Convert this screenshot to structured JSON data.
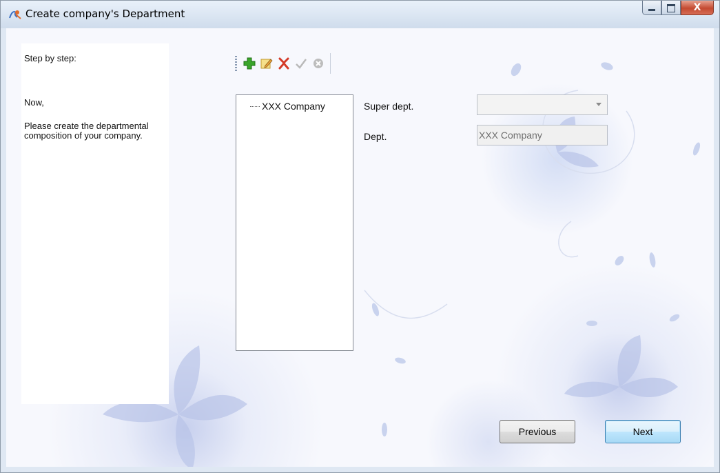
{
  "window": {
    "title": "Create company's Department",
    "caption_buttons": {
      "minimize_icon": "minimize-icon",
      "maximize_icon": "maximize-icon",
      "close_glyph": "X"
    }
  },
  "steps": {
    "title": "Step by step:",
    "now": "Now,",
    "description": "Please create the departmental composition of your company."
  },
  "toolbar": {
    "items": [
      {
        "icon": "add-icon",
        "enabled": true
      },
      {
        "icon": "edit-icon",
        "enabled": true
      },
      {
        "icon": "delete-icon",
        "enabled": true
      },
      {
        "icon": "confirm-icon",
        "enabled": false
      },
      {
        "icon": "cancel-icon",
        "enabled": false
      }
    ]
  },
  "tree": {
    "root": "XXX Company"
  },
  "form": {
    "super_dept_label": "Super dept.",
    "super_dept_value": "",
    "dept_label": "Dept.",
    "dept_value": "XXX Company"
  },
  "buttons": {
    "previous": "Previous",
    "next": "Next"
  },
  "colors": {
    "accent": "#3c7fb1",
    "background": "#f7f8fd",
    "close": "#c44a31"
  }
}
